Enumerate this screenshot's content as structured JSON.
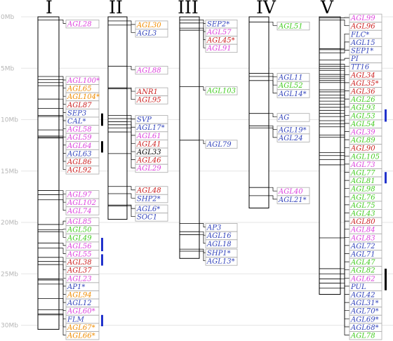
{
  "colors": {
    "pink": "#dd44dd",
    "orange": "#f08c00",
    "red": "#cc2222",
    "blue": "#3344bb",
    "green": "#44cc22",
    "black": "#000000",
    "bar_black": "#000000",
    "bar_blue": "#2233cc"
  },
  "axis": {
    "unit": "Mb",
    "max": 30,
    "ticks": [
      "0Mb",
      "5Mb",
      "10Mb",
      "15Mb",
      "20Mb",
      "25Mb",
      "30Mb"
    ]
  },
  "chromosomes": [
    {
      "name": "I",
      "length_mb": 30.4,
      "genes": [
        {
          "label": "AGL28",
          "color": "pink",
          "pos": 0.3
        },
        {
          "label": "AGL100*",
          "color": "pink",
          "pos": 5.8
        },
        {
          "label": "AGL65",
          "color": "orange",
          "pos": 6.1
        },
        {
          "label": "AGL104*",
          "color": "orange",
          "pos": 6.4
        },
        {
          "label": "AGL87",
          "color": "red",
          "pos": 6.7
        },
        {
          "label": "SEP3",
          "color": "blue",
          "pos": 8.0
        },
        {
          "label": "CAL*",
          "color": "blue",
          "pos": 8.9
        },
        {
          "label": "AGL58",
          "color": "pink",
          "pos": 9.6
        },
        {
          "label": "AGL59",
          "color": "pink",
          "pos": 9.7
        },
        {
          "label": "AGL64",
          "color": "pink",
          "pos": 11.0
        },
        {
          "label": "AGL63",
          "color": "blue",
          "pos": 11.6
        },
        {
          "label": "AGL86",
          "color": "red",
          "pos": 11.7
        },
        {
          "label": "AGL92",
          "color": "red",
          "pos": 11.8
        },
        {
          "label": "AGL97",
          "color": "pink",
          "pos": 16.9
        },
        {
          "label": "AGL102",
          "color": "pink",
          "pos": 17.3
        },
        {
          "label": "AGL74",
          "color": "pink",
          "pos": 17.8
        },
        {
          "label": "AGL85",
          "color": "pink",
          "pos": 20.2
        },
        {
          "label": "AGL50",
          "color": "green",
          "pos": 20.7
        },
        {
          "label": "AGL49",
          "color": "green",
          "pos": 20.9
        },
        {
          "label": "AGL56",
          "color": "pink",
          "pos": 22.0
        },
        {
          "label": "AGL55",
          "color": "pink",
          "pos": 22.5
        },
        {
          "label": "AGL38",
          "color": "red",
          "pos": 23.4
        },
        {
          "label": "AGL37",
          "color": "red",
          "pos": 23.8
        },
        {
          "label": "AGL23",
          "color": "pink",
          "pos": 24.1
        },
        {
          "label": "AP1*",
          "color": "blue",
          "pos": 25.5
        },
        {
          "label": "AGL94",
          "color": "orange",
          "pos": 25.6
        },
        {
          "label": "AGL12",
          "color": "blue",
          "pos": 26.0
        },
        {
          "label": "AGL60*",
          "color": "pink",
          "pos": 27.4
        },
        {
          "label": "FLM",
          "color": "blue",
          "pos": 28.5
        },
        {
          "label": "AGL67*",
          "color": "orange",
          "pos": 28.9
        },
        {
          "label": "AGL66*",
          "color": "orange",
          "pos": 29.0
        }
      ],
      "bars": [
        {
          "color": "bar_black",
          "from": 9.4,
          "to": 10.6
        },
        {
          "color": "bar_black",
          "from": 12.1,
          "to": 13.2
        },
        {
          "color": "bar_blue",
          "from": 21.5,
          "to": 22.8
        },
        {
          "color": "bar_blue",
          "from": 23.1,
          "to": 24.2
        },
        {
          "color": "bar_blue",
          "from": 29.0,
          "to": 30.1
        }
      ]
    },
    {
      "name": "II",
      "length_mb": 19.7,
      "genes": [
        {
          "label": "AGL30",
          "color": "orange",
          "pos": 0.4
        },
        {
          "label": "AGL3",
          "color": "blue",
          "pos": 0.8
        },
        {
          "label": "AGL88",
          "color": "pink",
          "pos": 4.8
        },
        {
          "label": "ANR1",
          "color": "red",
          "pos": 6.9
        },
        {
          "label": "AGL95",
          "color": "red",
          "pos": 7.0
        },
        {
          "label": "SVP",
          "color": "blue",
          "pos": 9.6
        },
        {
          "label": "AGL17*",
          "color": "blue",
          "pos": 9.9
        },
        {
          "label": "AGL61",
          "color": "pink",
          "pos": 10.2
        },
        {
          "label": "AGL41",
          "color": "red",
          "pos": 10.5
        },
        {
          "label": "AGL33",
          "color": "black",
          "pos": 10.8
        },
        {
          "label": "AGL46",
          "color": "red",
          "pos": 11.2
        },
        {
          "label": "AGL29",
          "color": "pink",
          "pos": 13.3
        },
        {
          "label": "AGL48",
          "color": "red",
          "pos": 16.5
        },
        {
          "label": "SHP2*",
          "color": "blue",
          "pos": 17.2
        },
        {
          "label": "AGL6*",
          "color": "blue",
          "pos": 18.3
        },
        {
          "label": "SOC1",
          "color": "blue",
          "pos": 18.4
        }
      ],
      "bars": []
    },
    {
      "name": "III",
      "length_mb": 23.5,
      "genes": [
        {
          "label": "SEP2*",
          "color": "blue",
          "pos": 0.3
        },
        {
          "label": "AGL57",
          "color": "pink",
          "pos": 0.6
        },
        {
          "label": "AGL45*",
          "color": "red",
          "pos": 1.1
        },
        {
          "label": "AGL91",
          "color": "pink",
          "pos": 1.3
        },
        {
          "label": "AGL103",
          "color": "green",
          "pos": 6.8
        },
        {
          "label": "AGL79",
          "color": "blue",
          "pos": 12.0
        },
        {
          "label": "AP3",
          "color": "blue",
          "pos": 20.1
        },
        {
          "label": "AGL16",
          "color": "blue",
          "pos": 20.9
        },
        {
          "label": "AGL18",
          "color": "blue",
          "pos": 21.2
        },
        {
          "label": "SHP1*",
          "color": "blue",
          "pos": 22.6
        },
        {
          "label": "AGL13*",
          "color": "blue",
          "pos": 22.8
        }
      ],
      "bars": []
    },
    {
      "name": "IV",
      "length_mb": 18.6,
      "genes": [
        {
          "label": "AGL51",
          "color": "green",
          "pos": 0.5
        },
        {
          "label": "AGL11",
          "color": "blue",
          "pos": 5.5
        },
        {
          "label": "AGL52",
          "color": "green",
          "pos": 5.8
        },
        {
          "label": "AGL14*",
          "color": "blue",
          "pos": 6.2
        },
        {
          "label": "AG",
          "color": "blue",
          "pos": 9.4
        },
        {
          "label": "AGL19*",
          "color": "blue",
          "pos": 10.6
        },
        {
          "label": "AGL24",
          "color": "blue",
          "pos": 10.8
        },
        {
          "label": "AGL40",
          "color": "pink",
          "pos": 16.6
        },
        {
          "label": "AGL21*",
          "color": "blue",
          "pos": 17.4
        }
      ],
      "bars": []
    },
    {
      "name": "V",
      "length_mb": 27.0,
      "genes": [
        {
          "label": "AGL99",
          "color": "pink",
          "pos": 0.1
        },
        {
          "label": "AGL96",
          "color": "red",
          "pos": 0.3
        },
        {
          "label": "FLC*",
          "color": "blue",
          "pos": 3.1
        },
        {
          "label": "AGL15",
          "color": "blue",
          "pos": 3.2
        },
        {
          "label": "SEP1*",
          "color": "blue",
          "pos": 3.5
        },
        {
          "label": "PI",
          "color": "blue",
          "pos": 4.2
        },
        {
          "label": "TT16",
          "color": "blue",
          "pos": 4.6
        },
        {
          "label": "AGL34",
          "color": "red",
          "pos": 4.8
        },
        {
          "label": "AGL35*",
          "color": "red",
          "pos": 5.0
        },
        {
          "label": "AGL36",
          "color": "red",
          "pos": 5.2
        },
        {
          "label": "AGL26",
          "color": "green",
          "pos": 5.6
        },
        {
          "label": "AGL93",
          "color": "green",
          "pos": 5.8
        },
        {
          "label": "AGL53",
          "color": "green",
          "pos": 6.0
        },
        {
          "label": "AGL54",
          "color": "green",
          "pos": 6.2
        },
        {
          "label": "AGL39",
          "color": "pink",
          "pos": 6.4
        },
        {
          "label": "AGL89",
          "color": "green",
          "pos": 7.1
        },
        {
          "label": "AGL90",
          "color": "red",
          "pos": 7.3
        },
        {
          "label": "AGL105",
          "color": "green",
          "pos": 7.6
        },
        {
          "label": "AGL73",
          "color": "pink",
          "pos": 7.9
        },
        {
          "label": "AGL77",
          "color": "green",
          "pos": 8.2
        },
        {
          "label": "AGL81",
          "color": "green",
          "pos": 8.5
        },
        {
          "label": "AGL98",
          "color": "green",
          "pos": 8.8
        },
        {
          "label": "AGL76",
          "color": "green",
          "pos": 9.1
        },
        {
          "label": "AGL75",
          "color": "green",
          "pos": 9.4
        },
        {
          "label": "AGL43",
          "color": "green",
          "pos": 9.7
        },
        {
          "label": "AGL80",
          "color": "red",
          "pos": 10.1
        },
        {
          "label": "AGL84",
          "color": "pink",
          "pos": 10.4
        },
        {
          "label": "AGL83",
          "color": "pink",
          "pos": 10.7
        },
        {
          "label": "AGL72",
          "color": "blue",
          "pos": 11.5
        },
        {
          "label": "AGL71",
          "color": "blue",
          "pos": 11.7
        },
        {
          "label": "AGL47",
          "color": "green",
          "pos": 13.2
        },
        {
          "label": "AGL82",
          "color": "green",
          "pos": 13.5
        },
        {
          "label": "AGL62",
          "color": "pink",
          "pos": 13.9
        },
        {
          "label": "PUL",
          "color": "blue",
          "pos": 14.4
        },
        {
          "label": "AGL42",
          "color": "blue",
          "pos": 21.5
        },
        {
          "label": "AGL31*",
          "color": "blue",
          "pos": 24.5
        },
        {
          "label": "AGL70*",
          "color": "blue",
          "pos": 25.0
        },
        {
          "label": "AGL69*",
          "color": "blue",
          "pos": 25.5
        },
        {
          "label": "AGL68*",
          "color": "blue",
          "pos": 25.9
        },
        {
          "label": "AGL78",
          "color": "green",
          "pos": 26.4
        }
      ],
      "bars": [
        {
          "color": "bar_blue",
          "from": 9.0,
          "to": 10.2
        },
        {
          "color": "bar_blue",
          "from": 15.1,
          "to": 16.2
        },
        {
          "color": "bar_black",
          "from": 24.5,
          "to": 26.6
        }
      ]
    }
  ]
}
